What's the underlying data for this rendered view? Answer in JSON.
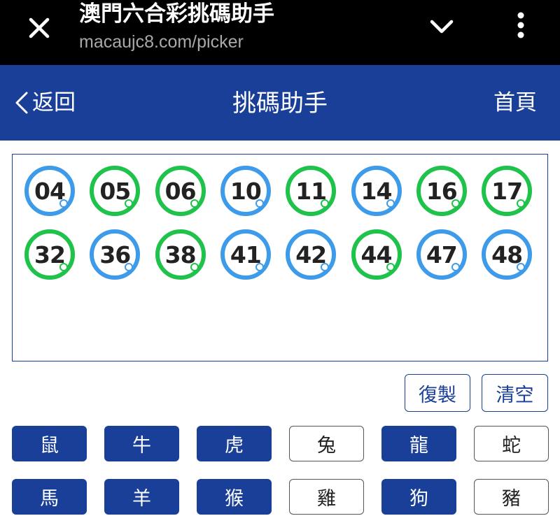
{
  "browser": {
    "title": "澳門六合彩挑碼助手",
    "url": "macaujc8.com/picker",
    "close_icon": "close-icon",
    "dropdown_icon": "chevron-down-icon",
    "menu_icon": "more-vertical-icon"
  },
  "header": {
    "back_label": "返回",
    "title": "挑碼助手",
    "home_label": "首頁"
  },
  "colors": {
    "brand_blue": "#1a3f99",
    "ball_blue": "#3d9be9",
    "ball_green": "#1fc24a"
  },
  "selected_numbers": [
    {
      "n": "04",
      "color": "blue"
    },
    {
      "n": "05",
      "color": "green"
    },
    {
      "n": "06",
      "color": "green"
    },
    {
      "n": "10",
      "color": "blue"
    },
    {
      "n": "11",
      "color": "green"
    },
    {
      "n": "14",
      "color": "blue"
    },
    {
      "n": "16",
      "color": "green"
    },
    {
      "n": "17",
      "color": "green"
    },
    {
      "n": "32",
      "color": "green"
    },
    {
      "n": "36",
      "color": "blue"
    },
    {
      "n": "38",
      "color": "green"
    },
    {
      "n": "41",
      "color": "blue"
    },
    {
      "n": "42",
      "color": "blue"
    },
    {
      "n": "44",
      "color": "green"
    },
    {
      "n": "47",
      "color": "blue"
    },
    {
      "n": "48",
      "color": "blue"
    }
  ],
  "actions": {
    "copy_label": "復製",
    "clear_label": "清空"
  },
  "zodiacs": [
    {
      "label": "鼠",
      "selected": true
    },
    {
      "label": "牛",
      "selected": true
    },
    {
      "label": "虎",
      "selected": true
    },
    {
      "label": "兔",
      "selected": false
    },
    {
      "label": "龍",
      "selected": true
    },
    {
      "label": "蛇",
      "selected": false
    },
    {
      "label": "馬",
      "selected": true
    },
    {
      "label": "羊",
      "selected": true
    },
    {
      "label": "猴",
      "selected": true
    },
    {
      "label": "雞",
      "selected": false
    },
    {
      "label": "狗",
      "selected": true
    },
    {
      "label": "豬",
      "selected": false
    }
  ]
}
